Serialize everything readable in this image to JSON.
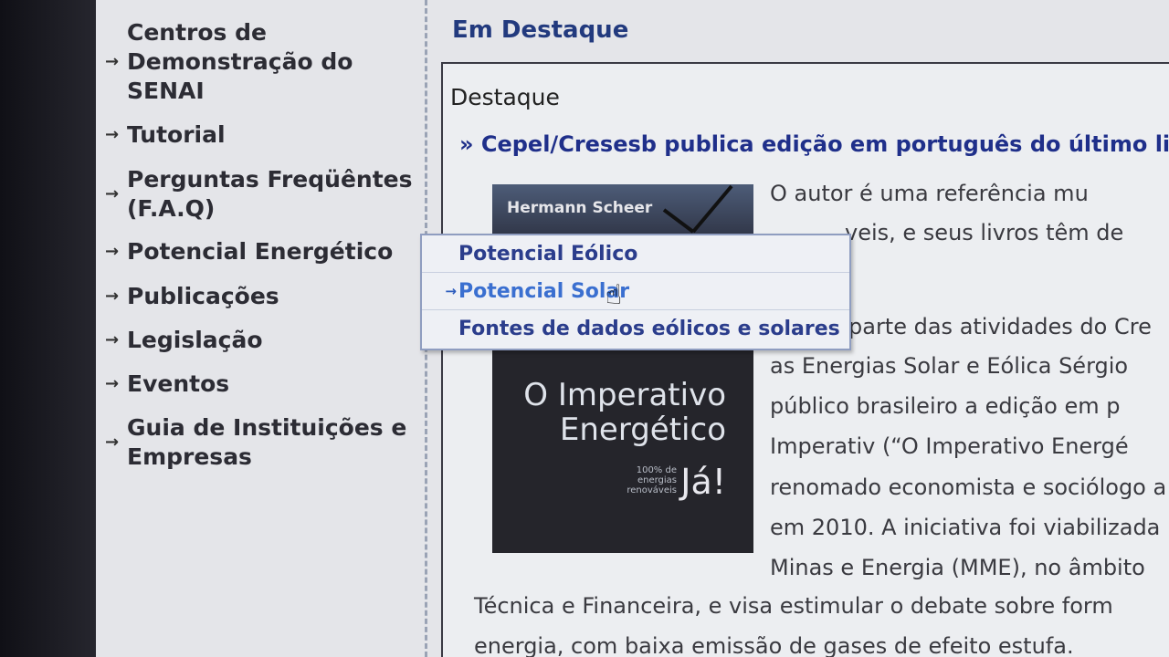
{
  "sidebar": {
    "items": [
      {
        "lines": [
          "Centros de",
          "Demonstração do",
          "SENAI"
        ]
      },
      {
        "lines": [
          "Tutorial"
        ]
      },
      {
        "lines": [
          "Perguntas Freqüêntes",
          "(F.A.Q)"
        ]
      },
      {
        "lines": [
          "Potencial Energético"
        ]
      },
      {
        "lines": [
          "Publicações"
        ]
      },
      {
        "lines": [
          "Legislação"
        ]
      },
      {
        "lines": [
          "Eventos"
        ]
      },
      {
        "lines": [
          "Guia de Instituições e",
          "Empresas"
        ]
      }
    ]
  },
  "main": {
    "section_title": "Em Destaque",
    "box_heading": "Destaque",
    "headline": "» Cepel/Cresesb publica edição em português do último livro",
    "book": {
      "author": "Hermann Scheer",
      "title_line1": "O Imperativo",
      "title_line2": "Energético",
      "sub_line1": "100% de",
      "sub_line2": "energias",
      "sub_line3": "renováveis",
      "ja": "Já!"
    },
    "paragraph": [
      "O autor é uma referência mu",
      "veis, e seus livros têm de",
      "parte das atividades do Cre",
      "as Energias Solar e Eólica Sérgio",
      "público brasileiro a edição em p",
      "Imperativ  (“O Imperativo Energé",
      "renomado economista e sociólogo a",
      "em 2010. A iniciativa foi viabilizada",
      "Minas e Energia (MME), no âmbito"
    ],
    "paragraph_full": [
      "Técnica e Financeira, e visa estimular o debate sobre form",
      "energia, com baixa emissão de gases de efeito estufa."
    ]
  },
  "dropdown": {
    "items": [
      "Potencial Eólico",
      "Potencial Solar",
      "Fontes de dados eólicos e solares"
    ]
  },
  "icons": {
    "arrow": "→",
    "cursor": "hand-pointer"
  }
}
